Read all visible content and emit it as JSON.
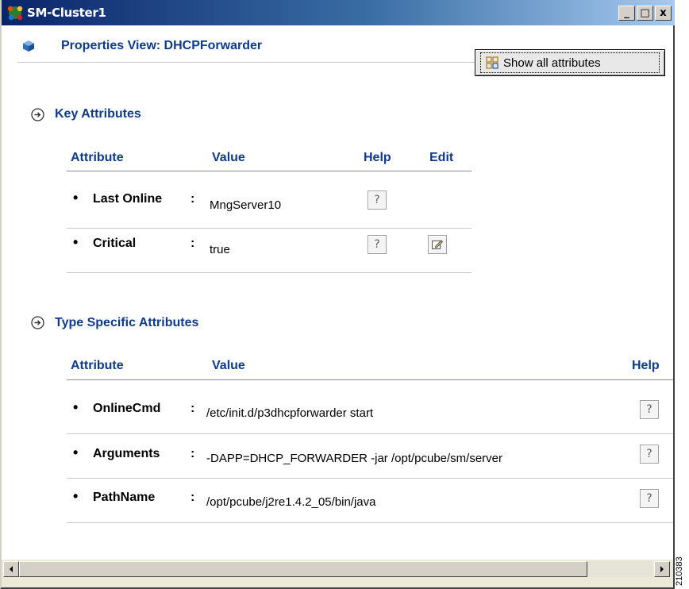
{
  "window": {
    "title": "SM-Cluster1",
    "buttons": {
      "minimize": "_",
      "maximize": "□",
      "close": "x"
    }
  },
  "header": {
    "title": "Properties View: DHCPForwarder",
    "show_all_button": "Show all attributes"
  },
  "key_attributes": {
    "title": "Key Attributes",
    "columns": {
      "attribute": "Attribute",
      "value": "Value",
      "help": "Help",
      "edit": "Edit"
    },
    "rows": [
      {
        "name": "Last Online",
        "colon": ":",
        "value": "MngServer10",
        "help": "?",
        "editable": false
      },
      {
        "name": "Critical",
        "colon": ":",
        "value": "true",
        "help": "?",
        "editable": true
      }
    ]
  },
  "type_specific_attributes": {
    "title": "Type Specific Attributes",
    "columns": {
      "attribute": "Attribute",
      "value": "Value",
      "help": "Help"
    },
    "rows": [
      {
        "name": "OnlineCmd",
        "colon": ":",
        "value": "/etc/init.d/p3dhcpforwarder start",
        "help": "?"
      },
      {
        "name": "Arguments",
        "colon": ":",
        "value": "-DAPP=DHCP_FORWARDER -jar /opt/pcube/sm/server",
        "help": "?"
      },
      {
        "name": "PathName",
        "colon": ":",
        "value": "/opt/pcube/j2re1.4.2_05/bin/java",
        "help": "?"
      }
    ]
  },
  "side_label": "210383",
  "colors": {
    "accent": "#0d3a8a",
    "titlebar": "#0a246a"
  },
  "icons": [
    "app-icon",
    "cube-icon",
    "grid-icon",
    "arrow-circle-icon",
    "help-icon",
    "edit-icon",
    "scroll-left-icon",
    "scroll-right-icon"
  ]
}
